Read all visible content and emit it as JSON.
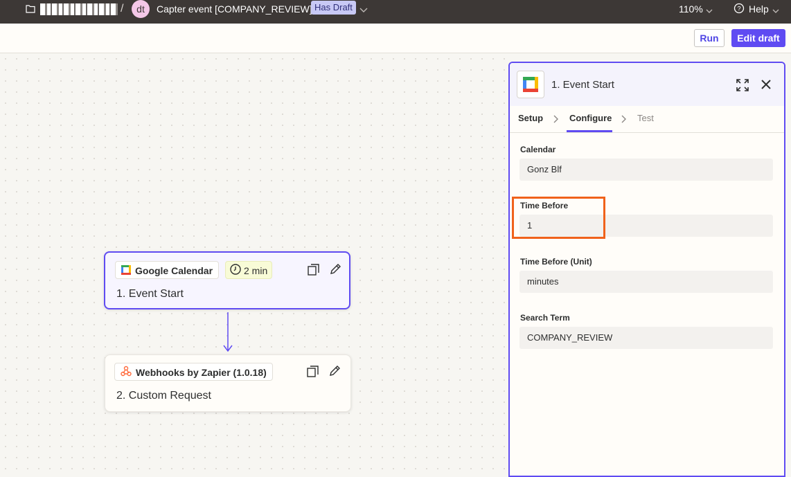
{
  "topbar": {
    "avatar_initials": "dt",
    "zap_name": "Capter event [COMPANY_REVIEW]",
    "draft_badge": "Has Draft",
    "zoom": "110%",
    "help": "Help"
  },
  "toolbar": {
    "run_label": "Run",
    "edit_draft_label": "Edit draft"
  },
  "canvas": {
    "steps": [
      {
        "app": "Google Calendar",
        "time_badge": "2 min",
        "title": "1. Event Start"
      },
      {
        "app": "Webhooks by Zapier (1.0.18)",
        "title": "2. Custom Request"
      }
    ]
  },
  "panel": {
    "title": "1. Event Start",
    "tabs": [
      "Setup",
      "Configure",
      "Test"
    ],
    "active_tab": "Configure",
    "fields": [
      {
        "label": "Calendar",
        "value": "Gonz Blf"
      },
      {
        "label": "Time Before",
        "value": "1"
      },
      {
        "label": "Time Before (Unit)",
        "value": "minutes"
      },
      {
        "label": "Search Term",
        "value": "COMPANY_REVIEW"
      }
    ]
  },
  "colors": {
    "accent": "#5f4bf2",
    "topbar_bg": "#3d3836",
    "highlight": "#f0621b"
  }
}
